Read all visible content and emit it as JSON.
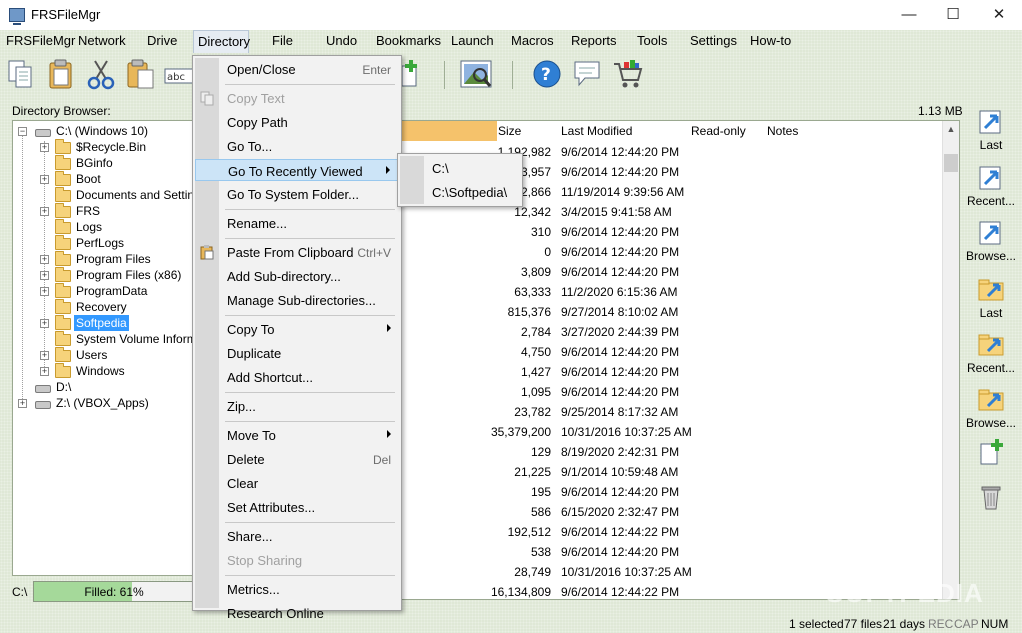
{
  "window": {
    "title": "FRSFileMgr",
    "min": "—",
    "max": "☐",
    "close": "✕"
  },
  "menubar": [
    {
      "label": "FRSFileMgr"
    },
    {
      "label": "Network"
    },
    {
      "label": "Drive"
    },
    {
      "label": "Directory"
    },
    {
      "label": "File"
    },
    {
      "label": "Undo"
    },
    {
      "label": "Bookmarks"
    },
    {
      "label": "Launch"
    },
    {
      "label": "Macros"
    },
    {
      "label": "Reports"
    },
    {
      "label": "Tools"
    },
    {
      "label": "Settings"
    },
    {
      "label": "How-to"
    }
  ],
  "toolbar_icons": [
    "copy-icon",
    "paste-icon",
    "cut-icon",
    "paste-special-icon",
    "abc-rename-icon",
    "new-file-icon",
    "image-viewer-icon",
    "help-icon",
    "chat-icon",
    "shopping-cart-icon"
  ],
  "directory_browser": {
    "label": "Directory Browser:",
    "tree": [
      {
        "label": "C:\\ (Windows 10)",
        "type": "drive",
        "expanded": true
      },
      {
        "label": "$Recycle.Bin",
        "type": "folder",
        "expandable": true
      },
      {
        "label": "BGinfo",
        "type": "folder",
        "expandable": false
      },
      {
        "label": "Boot",
        "type": "folder",
        "expandable": true
      },
      {
        "label": "Documents and Settings",
        "type": "folder",
        "expandable": false
      },
      {
        "label": "FRS",
        "type": "folder",
        "expandable": true
      },
      {
        "label": "Logs",
        "type": "folder",
        "expandable": false
      },
      {
        "label": "PerfLogs",
        "type": "folder",
        "expandable": false
      },
      {
        "label": "Program Files",
        "type": "folder",
        "expandable": true
      },
      {
        "label": "Program Files (x86)",
        "type": "folder",
        "expandable": true
      },
      {
        "label": "ProgramData",
        "type": "folder",
        "expandable": true
      },
      {
        "label": "Recovery",
        "type": "folder",
        "expandable": false
      },
      {
        "label": "Softpedia",
        "type": "folder",
        "expandable": true,
        "selected": true
      },
      {
        "label": "System Volume Informati",
        "type": "folder",
        "expandable": false
      },
      {
        "label": "Users",
        "type": "folder",
        "expandable": true
      },
      {
        "label": "Windows",
        "type": "folder",
        "expandable": true
      },
      {
        "label": "D:\\",
        "type": "drive",
        "expanded": false
      },
      {
        "label": "Z:\\ (VBOX_Apps)",
        "type": "drive",
        "expandable": true
      }
    ]
  },
  "drive_status": {
    "drive": "C:\\",
    "filled_label": "Filled:  61%",
    "filled_fraction": 0.61
  },
  "file_list": {
    "total_size": "1.13 MB",
    "columns": [
      "Size",
      "Last Modified",
      "Read-only",
      "Notes"
    ],
    "rows": [
      {
        "size": "1,192,982",
        "modified": "9/6/2014 12:44:20 PM"
      },
      {
        "size": "93,957",
        "modified": "9/6/2014 12:44:20 PM"
      },
      {
        "size": "202,866",
        "modified": "11/19/2014 9:39:56 AM"
      },
      {
        "size": "12,342",
        "modified": "3/4/2015 9:41:58 AM"
      },
      {
        "size": "310",
        "modified": "9/6/2014 12:44:20 PM"
      },
      {
        "size": "0",
        "modified": "9/6/2014 12:44:20 PM"
      },
      {
        "size": "3,809",
        "modified": "9/6/2014 12:44:20 PM"
      },
      {
        "size": "63,333",
        "modified": "11/2/2020 6:15:36 AM"
      },
      {
        "size": "815,376",
        "modified": "9/27/2014 8:10:02 AM"
      },
      {
        "size": "2,784",
        "modified": "3/27/2020 2:44:39 PM"
      },
      {
        "size": "4,750",
        "modified": "9/6/2014 12:44:20 PM"
      },
      {
        "size": "1,427",
        "modified": "9/6/2014 12:44:20 PM"
      },
      {
        "size": "1,095",
        "modified": "9/6/2014 12:44:20 PM"
      },
      {
        "size": "23,782",
        "modified": "9/25/2014 8:17:32 AM"
      },
      {
        "size": "35,379,200",
        "modified": "10/31/2016 10:37:25 AM"
      },
      {
        "size": "129",
        "modified": "8/19/2020 2:42:31 PM"
      },
      {
        "size": "21,225",
        "modified": "9/1/2014 10:59:48 AM"
      },
      {
        "size": "195",
        "modified": "9/6/2014 12:44:20 PM"
      },
      {
        "size": "586",
        "modified": "6/15/2020 2:32:47 PM"
      },
      {
        "size": "192,512",
        "modified": "9/6/2014 12:44:22 PM"
      },
      {
        "size": "538",
        "modified": "9/6/2014 12:44:20 PM"
      },
      {
        "size": "28,749",
        "modified": "10/31/2016 10:37:25 AM"
      },
      {
        "size": "16,134,809",
        "modified": "9/6/2014 12:44:22 PM"
      }
    ]
  },
  "sidebar": [
    {
      "label": "Last",
      "icon": "last-directory-icon"
    },
    {
      "label": "Recent...",
      "icon": "recent-directory-icon"
    },
    {
      "label": "Browse...",
      "icon": "browse-directory-icon"
    },
    {
      "label": "Last",
      "icon": "last-folder-icon"
    },
    {
      "label": "Recent...",
      "icon": "recent-folder-icon"
    },
    {
      "label": "Browse...",
      "icon": "browse-folder-icon"
    },
    {
      "label": "",
      "icon": "new-file-icon"
    },
    {
      "label": "",
      "icon": "trash-icon"
    }
  ],
  "context_menu": {
    "items": [
      {
        "label": "Open/Close",
        "shortcut": "Enter"
      },
      {
        "sep": true
      },
      {
        "label": "Copy Text",
        "disabled": true,
        "icon": "copy-icon"
      },
      {
        "label": "Copy Path"
      },
      {
        "label": "Go To..."
      },
      {
        "label": "Go To Recently Viewed",
        "submenu": true,
        "hover": true
      },
      {
        "label": "Go To System Folder..."
      },
      {
        "sep": true
      },
      {
        "label": "Rename..."
      },
      {
        "sep": true
      },
      {
        "label": "Paste From Clipboard",
        "shortcut": "Ctrl+V",
        "icon": "paste-icon"
      },
      {
        "label": "Add Sub-directory..."
      },
      {
        "label": "Manage Sub-directories..."
      },
      {
        "sep": true
      },
      {
        "label": "Copy To",
        "submenu": true
      },
      {
        "label": "Duplicate"
      },
      {
        "label": "Add Shortcut..."
      },
      {
        "sep": true
      },
      {
        "label": "Zip..."
      },
      {
        "sep": true
      },
      {
        "label": "Move To",
        "submenu": true
      },
      {
        "label": "Delete",
        "shortcut": "Del"
      },
      {
        "label": "Clear"
      },
      {
        "label": "Set Attributes..."
      },
      {
        "sep": true
      },
      {
        "label": "Share..."
      },
      {
        "label": "Stop Sharing",
        "disabled": true
      },
      {
        "sep": true
      },
      {
        "label": "Metrics..."
      },
      {
        "label": "Research Online"
      }
    ],
    "submenu_recent": [
      "C:\\",
      "C:\\Softpedia\\"
    ]
  },
  "statusbar": {
    "selected": "1 selected",
    "files": "77 files",
    "days": "21 days",
    "rec": "REC",
    "cap": "CAP",
    "num": "NUM"
  },
  "watermark": "SOFTPEDIA"
}
